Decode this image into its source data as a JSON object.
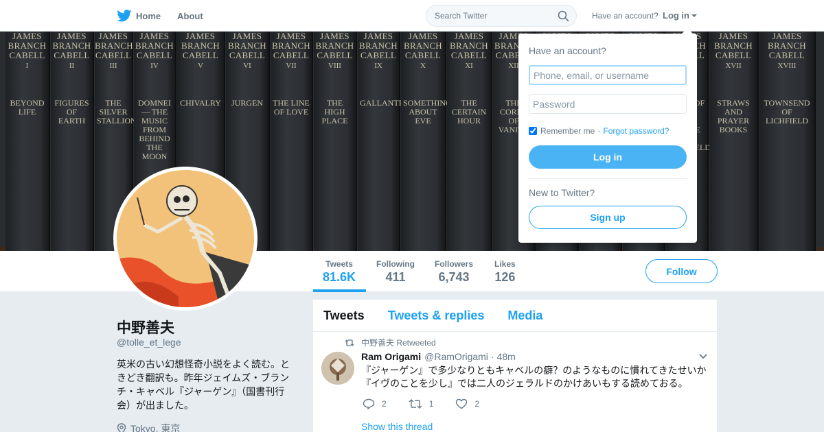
{
  "nav": {
    "home_label": "Home",
    "about_label": "About",
    "search_placeholder": "Search Twitter",
    "have_account": "Have an account?",
    "login_label": "Log in"
  },
  "header_books": [
    {
      "vol": "JAMES BRANCH CABELL",
      "num": "I",
      "title": "BEYOND LIFE"
    },
    {
      "vol": "JAMES BRANCH CABELL",
      "num": "II",
      "title": "FIGURES OF EARTH"
    },
    {
      "vol": "JAMES BRANCH CABELL",
      "num": "III",
      "title": "THE SILVER STALLION"
    },
    {
      "vol": "JAMES BRANCH CABELL",
      "num": "IV",
      "title": "DOMNEI — THE MUSIC FROM BEHIND THE MOON"
    },
    {
      "vol": "JAMES BRANCH CABELL",
      "num": "V",
      "title": "CHIVALRY"
    },
    {
      "vol": "JAMES BRANCH CABELL",
      "num": "VI",
      "title": "JURGEN"
    },
    {
      "vol": "JAMES BRANCH CABELL",
      "num": "VII",
      "title": "THE LINE OF LOVE"
    },
    {
      "vol": "JAMES BRANCH CABELL",
      "num": "VIII",
      "title": "THE HIGH PLACE"
    },
    {
      "vol": "JAMES BRANCH CABELL",
      "num": "IX",
      "title": "GALLANTRY"
    },
    {
      "vol": "JAMES BRANCH CABELL",
      "num": "X",
      "title": "SOMETHING ABOUT EVE"
    },
    {
      "vol": "JAMES BRANCH CABELL",
      "num": "XI",
      "title": "THE CERTAIN HOUR"
    },
    {
      "vol": "JAMES BRANCH CABELL",
      "num": "XII",
      "title": "THE CORDS OF VANITY"
    },
    {
      "vol": "JAMES BRANCH CABELL",
      "num": "",
      "title": ""
    },
    {
      "vol": "JAMES BRANCH CABELL",
      "num": "",
      "title": ""
    },
    {
      "vol": "JAMES BRANCH CABELL",
      "num": "",
      "title": ""
    },
    {
      "vol": "JAMES BRANCH CABELL",
      "num": "",
      "title": "FROM OF REST THE HOUSE OF LICHFIELD"
    },
    {
      "vol": "JAMES BRANCH CABELL",
      "num": "XVII",
      "title": "STRAWS AND PRAYER BOOKS"
    },
    {
      "vol": "JAMES BRANCH CABELL",
      "num": "XVIII",
      "title": "TOWNSEND OF LICHFIELD"
    }
  ],
  "stats": [
    {
      "label": "Tweets",
      "value": "81.6K"
    },
    {
      "label": "Following",
      "value": "411"
    },
    {
      "label": "Followers",
      "value": "6,743"
    },
    {
      "label": "Likes",
      "value": "126"
    }
  ],
  "follow_label": "Follow",
  "profile": {
    "name": "中野善夫",
    "handle": "@tolle_et_lege",
    "bio": "英米の古い幻想怪奇小説をよく読む。ときどき翻訳も。昨年ジェイムズ・ブランチ・キャベル『ジャーゲン』（国書刊行会）が出ました。",
    "location": "Tokyo, 東京"
  },
  "timeline": {
    "tabs": [
      "Tweets",
      "Tweets & replies",
      "Media"
    ],
    "tweet": {
      "retweet_context": "中野善夫 Retweeted",
      "author_name": "Ram Origami",
      "author_handle": "@RamOrigami",
      "time": "48m",
      "text": "『ジャーゲン』で多少なりともキャベルの癖？のようなものに慣れてきたせいか『イヴのことを少し』では二人のジェラルドのかけあいもする読めておる。",
      "replies": "2",
      "retweets": "1",
      "likes": "2",
      "show_thread": "Show this thread"
    }
  },
  "login_dropdown": {
    "title": "Have an account?",
    "username_placeholder": "Phone, email, or username",
    "password_placeholder": "Password",
    "remember_label": "Remember me",
    "separator": "·",
    "forgot_label": "Forgot password?",
    "login_button": "Log in",
    "new_label": "New to Twitter?",
    "signup_button": "Sign up"
  },
  "colors": {
    "brand_blue": "#1da1f2",
    "login_button_bg": "#4ab3f4",
    "page_bg": "#e6ecf0"
  }
}
